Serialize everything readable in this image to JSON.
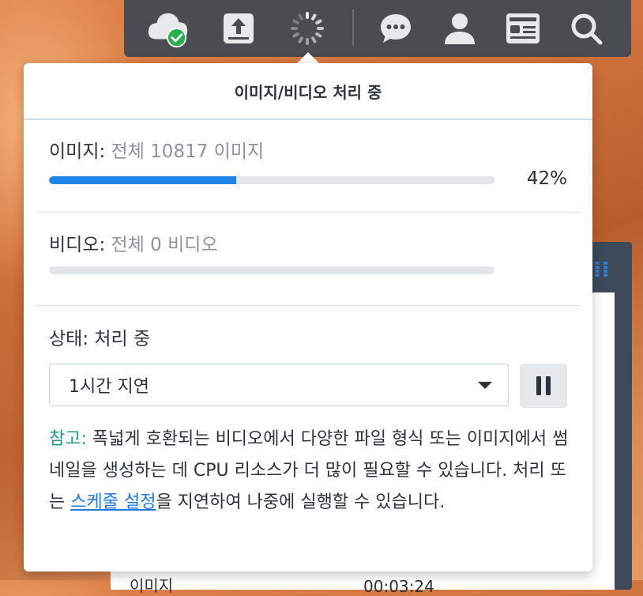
{
  "colors": {
    "accent": "#1f86e8",
    "note_label": "#1a9b8f",
    "link": "#1f7ae0",
    "taskbar": "#494d52",
    "sync_ok": "#23b14d"
  },
  "taskbar": {
    "icons": [
      "cloud-sync-ok-icon",
      "upload-icon",
      "loading-spinner-icon",
      "chat-icon",
      "user-icon",
      "widgets-icon",
      "search-icon"
    ]
  },
  "background": {
    "row_label": "이미지",
    "row_time": "00:03:24"
  },
  "popup": {
    "title": "이미지/비디오 처리 중",
    "images": {
      "label": "이미지:",
      "detail": "전체 10817 이미지",
      "progress": 0.42,
      "percent_text": "42%"
    },
    "videos": {
      "label": "비디오:",
      "detail": "전체 0 비디오",
      "progress": 0
    },
    "status": {
      "text": "상태: 처리 중"
    },
    "delay_select": {
      "value": "1시간 지연"
    },
    "note": {
      "label": "참고:",
      "text_before": " 폭넓게 호환되는 비디오에서 다양한 파일 형식 또는 이미지에서 썸네일을 생성하는 데 CPU 리소스가 더 많이 필요할 수 있습니다. 처리 또는 ",
      "link": "스케줄 설정",
      "text_after": "을 지연하여 나중에 실행할 수 있습니다."
    }
  }
}
